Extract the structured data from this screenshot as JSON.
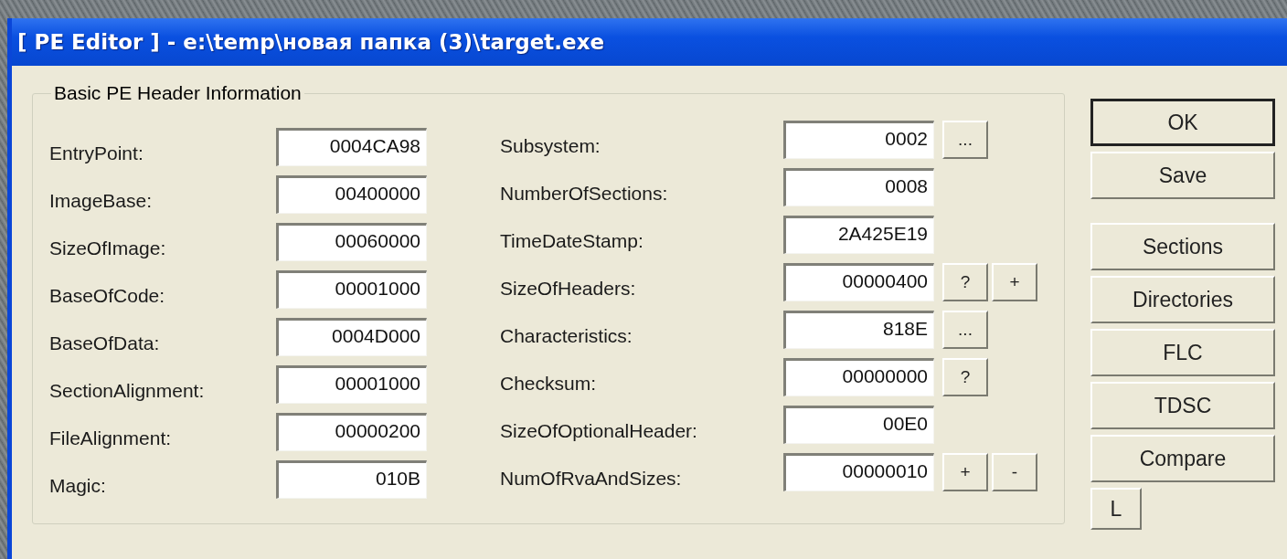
{
  "window": {
    "title": "[ PE Editor ] - e:\\temp\\новая папка (3)\\target.exe"
  },
  "group": {
    "legend": "Basic PE Header Information",
    "left_fields": [
      {
        "label": "EntryPoint:",
        "value": "0004CA98"
      },
      {
        "label": "ImageBase:",
        "value": "00400000"
      },
      {
        "label": "SizeOfImage:",
        "value": "00060000"
      },
      {
        "label": "BaseOfCode:",
        "value": "00001000"
      },
      {
        "label": "BaseOfData:",
        "value": "0004D000"
      },
      {
        "label": "SectionAlignment:",
        "value": "00001000"
      },
      {
        "label": "FileAlignment:",
        "value": "00000200"
      },
      {
        "label": "Magic:",
        "value": "010B"
      }
    ],
    "right_fields": [
      {
        "label": "Subsystem:",
        "value": "0002",
        "buttons": [
          "..."
        ]
      },
      {
        "label": "NumberOfSections:",
        "value": "0008"
      },
      {
        "label": "TimeDateStamp:",
        "value": "2A425E19"
      },
      {
        "label": "SizeOfHeaders:",
        "value": "00000400",
        "buttons": [
          "?",
          "+"
        ]
      },
      {
        "label": "Characteristics:",
        "value": "818E",
        "buttons": [
          "..."
        ]
      },
      {
        "label": "Checksum:",
        "value": "00000000",
        "buttons": [
          "?"
        ]
      },
      {
        "label": "SizeOfOptionalHeader:",
        "value": "00E0"
      },
      {
        "label": "NumOfRvaAndSizes:",
        "value": "00000010",
        "buttons": [
          "+",
          "-"
        ]
      }
    ]
  },
  "side_buttons": [
    {
      "label": "OK",
      "default": true,
      "kind": "wide"
    },
    {
      "label": "Save",
      "default": false,
      "kind": "wide"
    },
    {
      "label": "Sections",
      "default": false,
      "kind": "wide"
    },
    {
      "label": "Directories",
      "default": false,
      "kind": "wide"
    },
    {
      "label": "FLC",
      "default": false,
      "kind": "wide"
    },
    {
      "label": "TDSC",
      "default": false,
      "kind": "wide"
    },
    {
      "label": "Compare",
      "default": false,
      "kind": "wide"
    },
    {
      "label": "L",
      "default": false,
      "kind": "small"
    }
  ]
}
